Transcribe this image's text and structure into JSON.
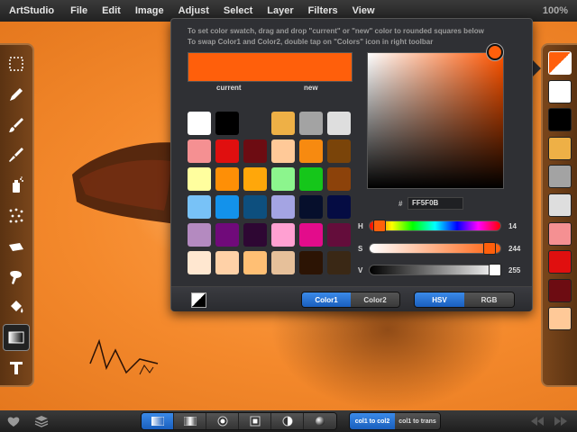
{
  "menubar": {
    "app_name": "ArtStudio",
    "items": [
      "File",
      "Edit",
      "Image",
      "Adjust",
      "Select",
      "Layer",
      "Filters",
      "View"
    ],
    "zoom": "100%"
  },
  "left_tools": [
    {
      "name": "marquee-select-icon",
      "active": false
    },
    {
      "name": "pencil-icon",
      "active": false
    },
    {
      "name": "brush-icon",
      "active": false
    },
    {
      "name": "smudge-icon",
      "active": false
    },
    {
      "name": "spray-icon",
      "active": false
    },
    {
      "name": "scatter-icon",
      "active": false
    },
    {
      "name": "eraser-icon",
      "active": false
    },
    {
      "name": "smudge-finger-icon",
      "active": false
    },
    {
      "name": "paint-bucket-icon",
      "active": false
    },
    {
      "name": "gradient-icon",
      "active": true
    },
    {
      "name": "text-tool-icon",
      "active": false
    }
  ],
  "right_palette": {
    "swatches": [
      "#ffffff",
      "#000000",
      "#eeb046",
      "#a3a3a3",
      "#dedede",
      "#f59092",
      "#e00f0f",
      "#6d0c12",
      "#ffc998"
    ]
  },
  "color_popup": {
    "hint_line_1": "To set color swatch, drag and drop \"current\" or \"new\" color to rounded squares below",
    "hint_line_2": "To swap Color1 and Color2, double tap on \"Colors\" icon in right toolbar",
    "current_label": "current",
    "new_label": "new",
    "current_color": "#ff5f0b",
    "new_color": "#ff5f0b",
    "swatches": [
      "#ffffff",
      "#000000",
      "",
      "#eeb046",
      "#a3a3a3",
      "#dedede",
      "#f59092",
      "#e00f0f",
      "#6d0c12",
      "#ffc998",
      "#f78a10",
      "#7a4409",
      "#fffe9e",
      "#fe8f06",
      "#ffa70a",
      "#8cf58d",
      "#15c61a",
      "#8c420a",
      "#78c2f7",
      "#1392eb",
      "#0d4f7e",
      "#a4a4e3",
      "#060f2c",
      "#050c43",
      "#b48ac0",
      "#700a7a",
      "#2e0733",
      "#ffa0d2",
      "#e30c8b",
      "#640d3b",
      "#ffe7d0",
      "#ffd1a7",
      "#ffbf74",
      "#e6c09a",
      "#2c1404",
      "#3a2815"
    ],
    "hex_prefix": "#",
    "hex_value": "FF5F0B",
    "hue": {
      "label": "H",
      "value": "14",
      "fraction": 0.04
    },
    "saturation": {
      "label": "S",
      "value": "244",
      "fraction": 0.957
    },
    "value": {
      "label": "V",
      "value": "255",
      "fraction": 1.0
    },
    "footer": {
      "color1_label": "Color1",
      "color2_label": "Color2",
      "hsv_label": "HSV",
      "rgb_label": "RGB"
    }
  },
  "bottombar": {
    "fill_col1_to_col2": "col1 to col2",
    "fill_col1_to_trans": "col1 to trans"
  },
  "colors": {
    "accent_blue": "#1a5fbe",
    "current_orange": "#ff5f0b"
  }
}
